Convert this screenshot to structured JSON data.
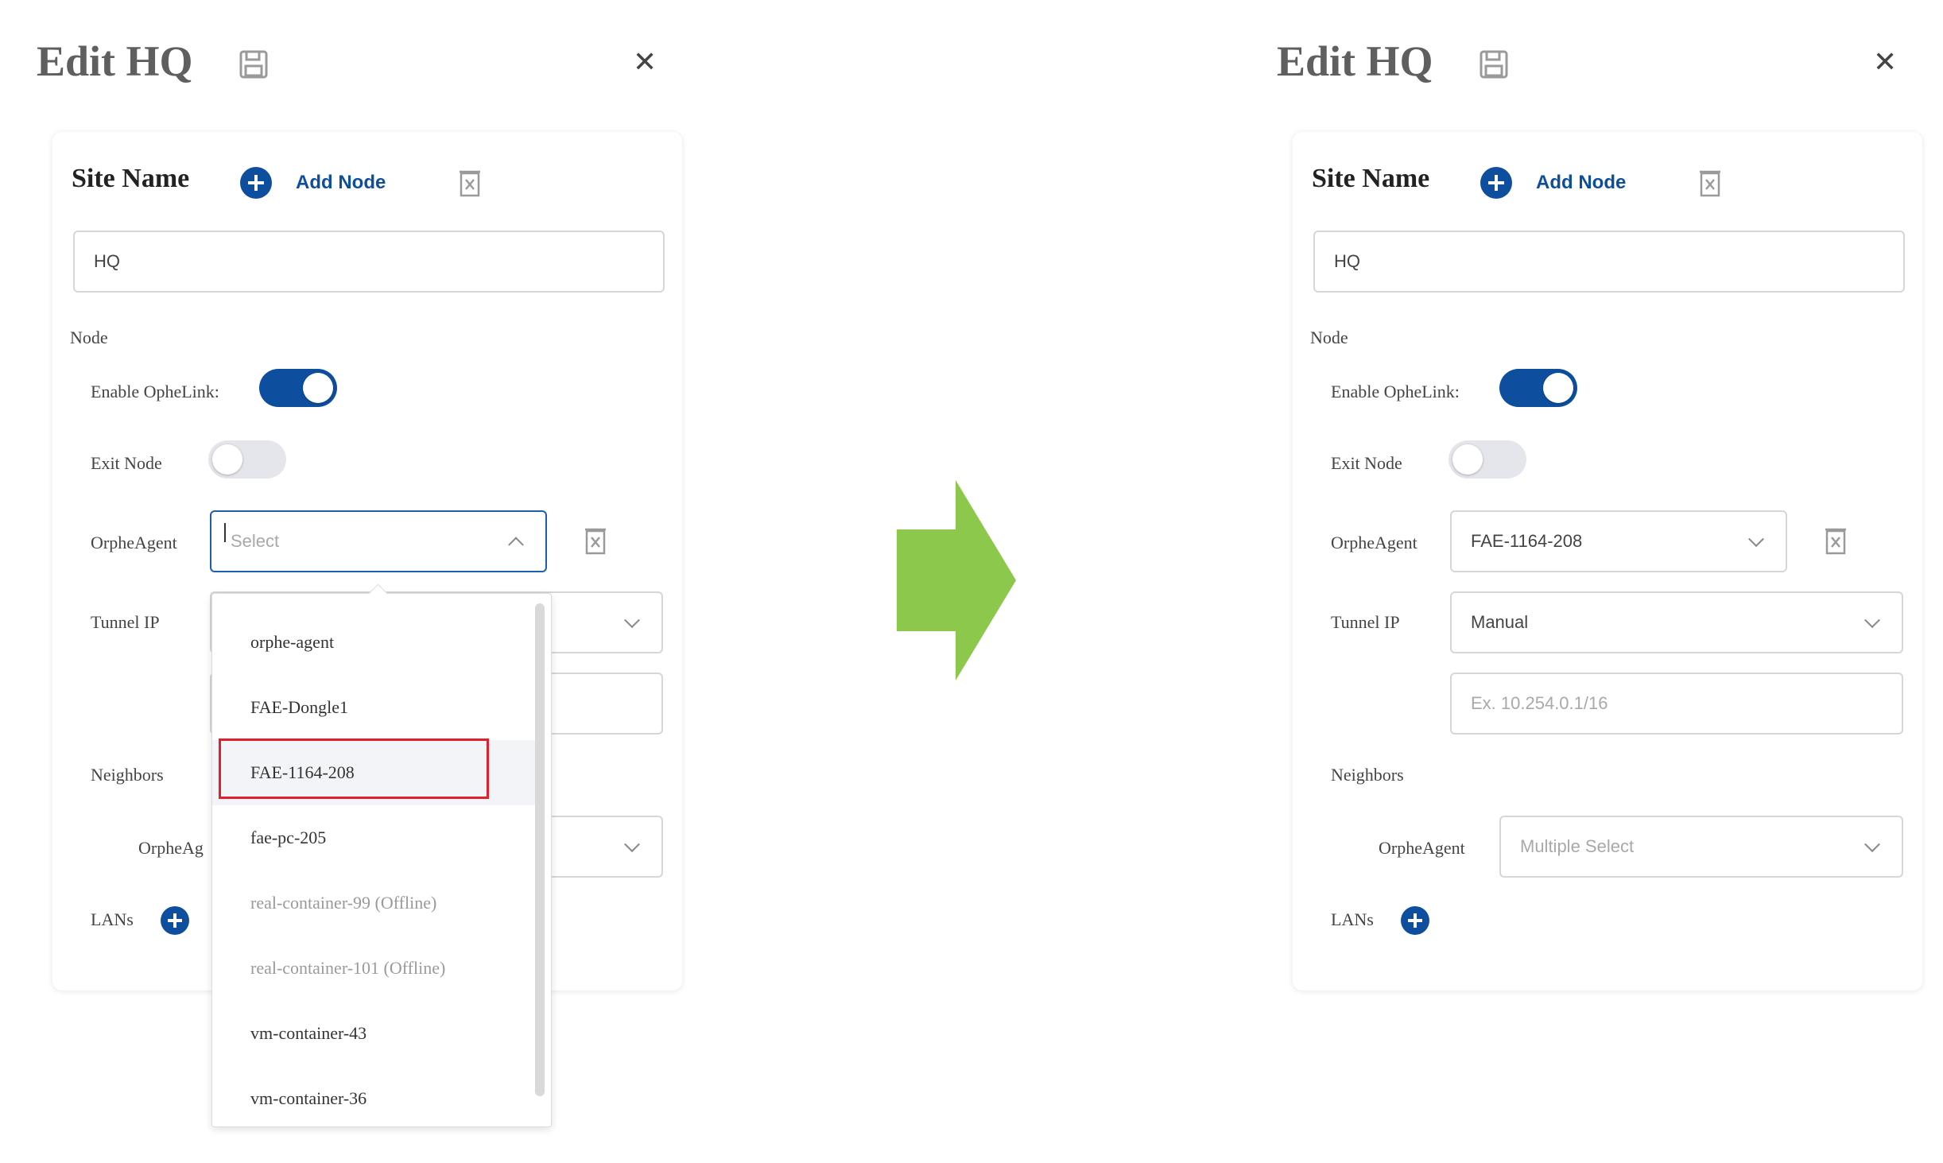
{
  "before": {
    "title": "Edit HQ",
    "site_name_label": "Site Name",
    "add_node_label": "Add Node",
    "site_name_value": "HQ",
    "node_label": "Node",
    "enable_label": "Enable OpheLink:",
    "exit_node_label": "Exit Node",
    "orphe_agent_label": "OrpheAgent",
    "orphe_agent_placeholder": "Select",
    "tunnel_ip_label": "Tunnel IP",
    "neighbors_label": "Neighbors",
    "neighbors_agent_label": "OrpheAg",
    "lans_label": "LANs",
    "dropdown_options": [
      "orphe-agent",
      "FAE-Dongle1",
      "FAE-1164-208",
      "fae-pc-205",
      "real-container-99 (Offline)",
      "real-container-101 (Offline)",
      "vm-container-43",
      "vm-container-36"
    ],
    "enable_orphelink": true,
    "exit_node": false
  },
  "after": {
    "title": "Edit HQ",
    "site_name_label": "Site Name",
    "add_node_label": "Add Node",
    "site_name_value": "HQ",
    "node_label": "Node",
    "enable_label": "Enable OpheLink:",
    "exit_node_label": "Exit Node",
    "orphe_agent_label": "OrpheAgent",
    "orphe_agent_value": "FAE-1164-208",
    "tunnel_ip_label": "Tunnel IP",
    "tunnel_ip_value": "Manual",
    "tunnel_ip_placeholder": "Ex. 10.254.0.1/16",
    "neighbors_label": "Neighbors",
    "neighbors_agent_label": "OrpheAgent",
    "neighbors_agent_placeholder": "Multiple Select",
    "lans_label": "LANs",
    "enable_orphelink": true,
    "exit_node": false
  },
  "colors": {
    "accent": "#0d4f9e",
    "highlight": "#e0202a",
    "arrow": "#8cc84b"
  },
  "icons": [
    "save-icon",
    "close-icon",
    "add-icon",
    "trash-icon",
    "chevron-down-icon",
    "chevron-up-icon",
    "right-arrow-icon"
  ]
}
